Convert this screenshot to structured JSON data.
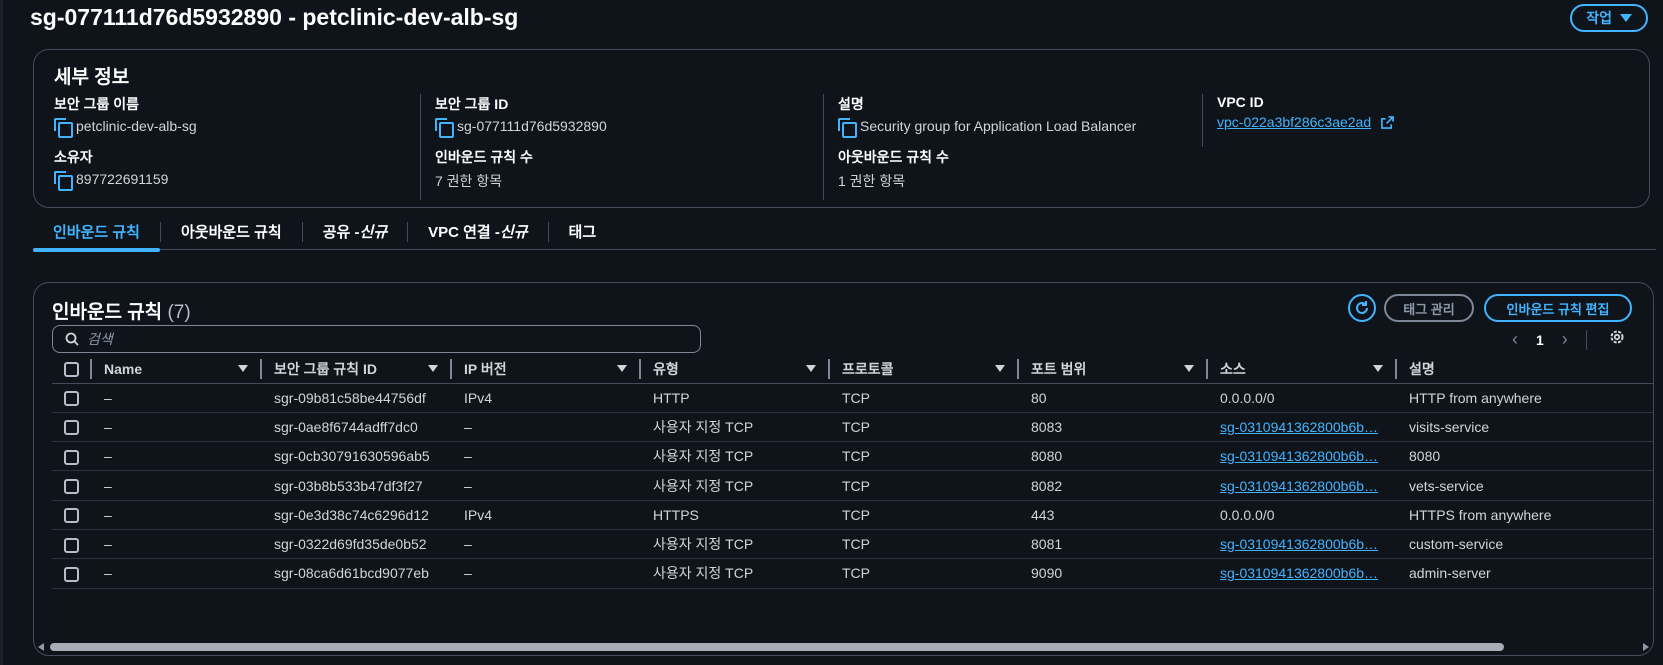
{
  "page": {
    "title": "sg-077111d76d5932890 - petclinic-dev-alb-sg",
    "actions_label": "작업"
  },
  "details": {
    "title": "세부 정보",
    "fields": [
      {
        "label": "보안 그룹 이름",
        "value": "petclinic-dev-alb-sg",
        "copy": true
      },
      {
        "label": "보안 그룹 ID",
        "value": "sg-077111d76d5932890",
        "copy": true
      },
      {
        "label": "설명",
        "value": "Security group for Application Load Balancer",
        "copy": true
      },
      {
        "label": "VPC ID",
        "value": "vpc-022a3bf286c3ae2ad",
        "link": true
      },
      {
        "label": "소유자",
        "value": "897722691159",
        "copy": true
      },
      {
        "label": "인바운드 규칙 수",
        "value": "7 권한 항목"
      },
      {
        "label": "아웃바운드 규칙 수",
        "value": "1 권한 항목"
      }
    ]
  },
  "tabs": [
    {
      "label": "인바운드 규칙",
      "active": true
    },
    {
      "label": "아웃바운드 규칙"
    },
    {
      "label": "공유 - ",
      "suffix": "신규"
    },
    {
      "label": "VPC 연결 - ",
      "suffix": "신규"
    },
    {
      "label": "태그"
    }
  ],
  "rules": {
    "title": "인바운드 규칙",
    "count": "(7)",
    "manage_tags_label": "태그 관리",
    "edit_label": "인바운드 규칙 편집",
    "search_placeholder": "검색",
    "page_number": "1",
    "columns": [
      "Name",
      "보안 그룹 규칙 ID",
      "IP 버전",
      "유형",
      "프로토콜",
      "포트 범위",
      "소스",
      "설명"
    ],
    "rows": [
      {
        "name": "–",
        "rule_id": "sgr-09b81c58be44756df",
        "ip_version": "IPv4",
        "type": "HTTP",
        "protocol": "TCP",
        "port": "80",
        "source": "0.0.0.0/0",
        "source_link": false,
        "description": "HTTP from anywhere"
      },
      {
        "name": "–",
        "rule_id": "sgr-0ae8f6744adff7dc0",
        "ip_version": "–",
        "type": "사용자 지정 TCP",
        "protocol": "TCP",
        "port": "8083",
        "source": "sg-0310941362800b6b…",
        "source_link": true,
        "description": "visits-service"
      },
      {
        "name": "–",
        "rule_id": "sgr-0cb30791630596ab5",
        "ip_version": "–",
        "type": "사용자 지정 TCP",
        "protocol": "TCP",
        "port": "8080",
        "source": "sg-0310941362800b6b…",
        "source_link": true,
        "description": "8080"
      },
      {
        "name": "–",
        "rule_id": "sgr-03b8b533b47df3f27",
        "ip_version": "–",
        "type": "사용자 지정 TCP",
        "protocol": "TCP",
        "port": "8082",
        "source": "sg-0310941362800b6b…",
        "source_link": true,
        "description": "vets-service"
      },
      {
        "name": "–",
        "rule_id": "sgr-0e3d38c74c6296d12",
        "ip_version": "IPv4",
        "type": "HTTPS",
        "protocol": "TCP",
        "port": "443",
        "source": "0.0.0.0/0",
        "source_link": false,
        "description": "HTTPS from anywhere"
      },
      {
        "name": "–",
        "rule_id": "sgr-0322d69fd35de0b52",
        "ip_version": "–",
        "type": "사용자 지정 TCP",
        "protocol": "TCP",
        "port": "8081",
        "source": "sg-0310941362800b6b…",
        "source_link": true,
        "description": "custom-service"
      },
      {
        "name": "–",
        "rule_id": "sgr-08ca6d61bcd9077eb",
        "ip_version": "–",
        "type": "사용자 지정 TCP",
        "protocol": "TCP",
        "port": "9090",
        "source": "sg-0310941362800b6b…",
        "source_link": true,
        "description": "admin-server"
      }
    ]
  },
  "colors": {
    "background": "#0f141a",
    "accent": "#42b4ff",
    "border": "#414d5c",
    "text": "#d1d5db"
  }
}
